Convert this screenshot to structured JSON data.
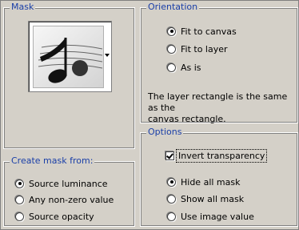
{
  "mask": {
    "group_label": "Mask",
    "preview_icon": "music-note-thumbnail-icon"
  },
  "orientation": {
    "group_label": "Orientation",
    "options": [
      {
        "label": "Fit to canvas",
        "selected": true
      },
      {
        "label": "Fit to layer",
        "selected": false
      },
      {
        "label": "As is",
        "selected": false
      }
    ],
    "note_line1": "The layer rectangle is the same as the",
    "note_line2": "canvas rectangle."
  },
  "create_mask": {
    "group_label": "Create mask from:",
    "options": [
      {
        "label": "Source luminance",
        "selected": true
      },
      {
        "label": "Any non-zero value",
        "selected": false
      },
      {
        "label": "Source opacity",
        "selected": false
      }
    ]
  },
  "options": {
    "group_label": "Options",
    "invert_label": "Invert transparency",
    "invert_checked": true,
    "mask_options": [
      {
        "label": "Hide all mask",
        "selected": true
      },
      {
        "label": "Show all mask",
        "selected": false
      },
      {
        "label": "Use image value",
        "selected": false
      }
    ]
  }
}
